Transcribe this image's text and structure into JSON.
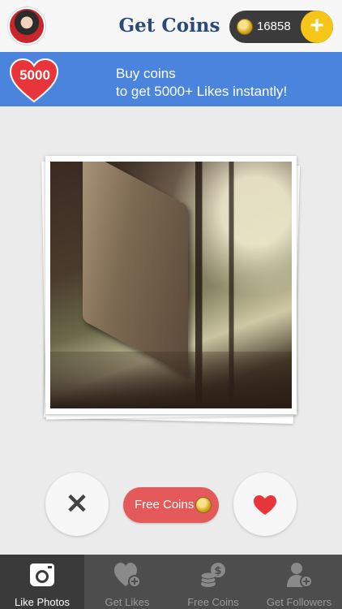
{
  "header": {
    "title": "Get Coins",
    "coin_balance": "16858",
    "plus_label": "+"
  },
  "banner": {
    "heart_value": "5000",
    "line1": "Buy coins",
    "line2": "to get 5000+ Likes instantly!"
  },
  "actions": {
    "skip_label": "✕",
    "free_coins_label": "Free Coins"
  },
  "tabs": [
    {
      "label": "Like Photos",
      "icon": "camera-icon",
      "active": true
    },
    {
      "label": "Get Likes",
      "icon": "heart-plus-icon",
      "active": false
    },
    {
      "label": "Free Coins",
      "icon": "coin-stack-icon",
      "active": false
    },
    {
      "label": "Get Followers",
      "icon": "user-plus-icon",
      "active": false
    }
  ],
  "colors": {
    "banner": "#4a84dd",
    "title": "#2a4a7d",
    "accent_yellow": "#f5c518",
    "accent_red": "#e45a5a",
    "tabbar": "#4d4d4d"
  }
}
